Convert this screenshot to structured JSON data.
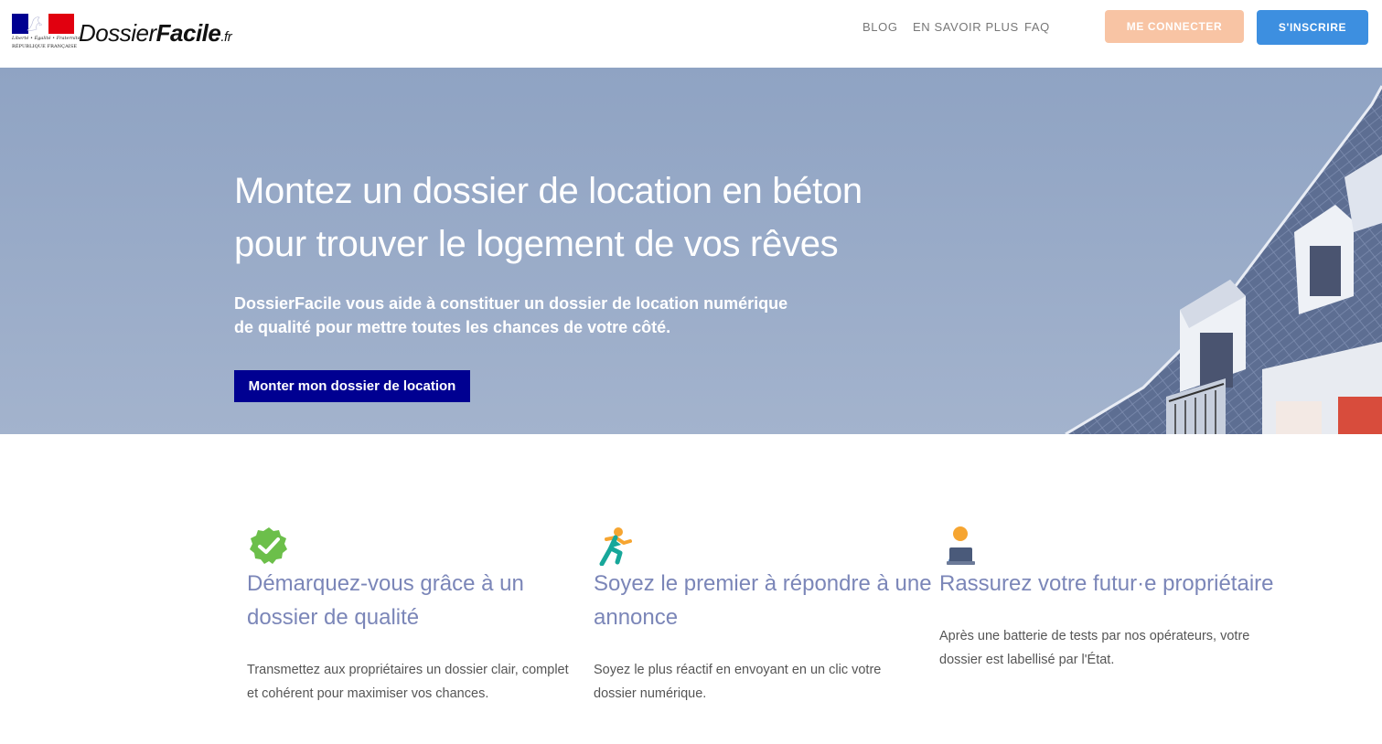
{
  "header": {
    "logo": {
      "motto": "Liberté • Égalité • Fraternité",
      "republique": "RÉPUBLIQUE FRANÇAISE",
      "brand_part1": "Dossier",
      "brand_part2": "Facile",
      "brand_part3": ".fr"
    },
    "nav": [
      "BLOG",
      "EN SAVOIR PLUS",
      "FAQ"
    ],
    "login_label": "ME CONNECTER",
    "signup_label": "S'INSCRIRE"
  },
  "hero": {
    "title_line1": "Montez un dossier de location en béton",
    "title_line2": "pour trouver le logement de vos rêves",
    "subtitle_line1": "DossierFacile vous aide à constituer un dossier de location numérique",
    "subtitle_line2": "de qualité pour mettre toutes les chances de votre côté.",
    "cta_label": "Monter mon dossier de location"
  },
  "features": [
    {
      "icon": "check-badge-icon",
      "title": "Démarquez-vous grâce à un dossier de qualité",
      "text": "Transmettez aux propriétaires un dossier clair, complet et cohérent pour maximiser vos chances."
    },
    {
      "icon": "running-person-icon",
      "title": "Soyez le premier à répondre à une annonce",
      "text": "Soyez le plus réactif en envoyant en un clic votre dossier numérique."
    },
    {
      "icon": "person-laptop-icon",
      "title": "Rassurez votre futur·e propriétaire",
      "text": "Après une batterie de tests par nos opérateurs, votre dossier est labellisé par l'État."
    }
  ],
  "colors": {
    "navy": "#000091",
    "login_button": "#f8c4a4",
    "signup_button": "#3d8fe0",
    "hero_sky": "#93a7c5",
    "feature_title": "#7b86b8"
  }
}
